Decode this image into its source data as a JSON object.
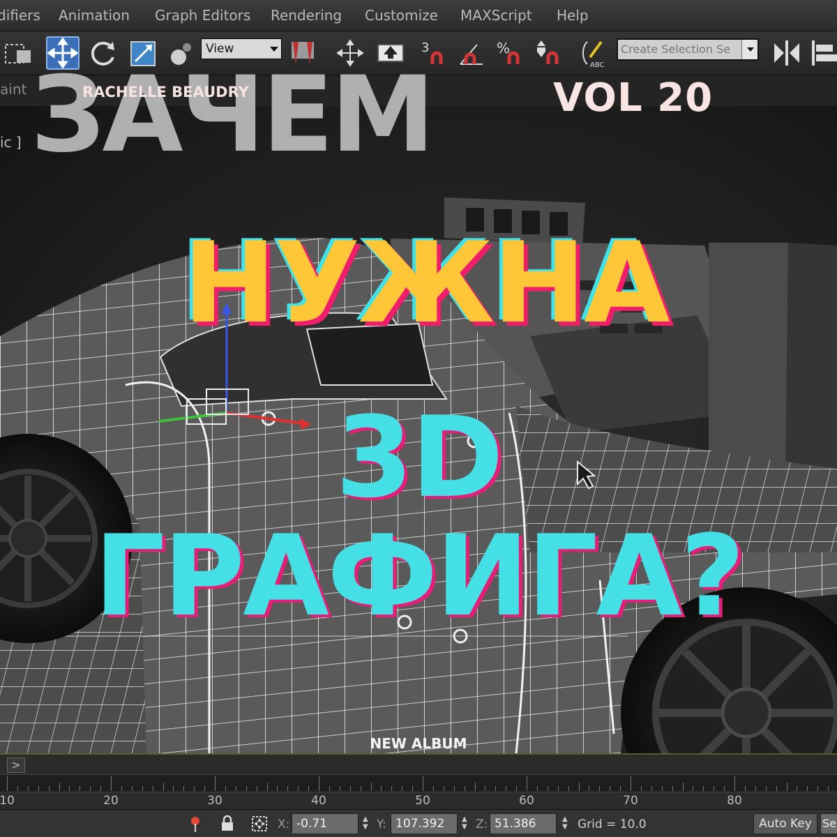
{
  "menu": [
    "difiers",
    "Animation",
    "Graph Editors",
    "Rendering",
    "Customize",
    "MAXScript",
    "Help"
  ],
  "toolbar": {
    "view_dropdown": "View",
    "snap_labels": [
      "3",
      "%"
    ],
    "selection_set_placeholder": "Create Selection Se"
  },
  "ribbon": {
    "label": "aint"
  },
  "viewport": {
    "label": "ic ]"
  },
  "poster": {
    "title_top": "ЗАЧЕМ",
    "artist": "RACHELLE BEAUDRY",
    "volume": "VOL 20",
    "line1": "НУЖНА",
    "line2": "3D",
    "line3": "ГРАФИГА?",
    "album": "NEW ALBUM",
    "colors": {
      "yellow": "#ffc637",
      "cyan": "#45dfe6",
      "magenta": "#e51f78",
      "pink_white": "#f9e4e4",
      "grey": "#b8b8b8"
    }
  },
  "timeline": {
    "arrow": ">",
    "ticks": [
      "10",
      "20",
      "30",
      "40",
      "50",
      "60",
      "70",
      "80"
    ]
  },
  "status": {
    "x_label": "X:",
    "x_value": "-0.71",
    "y_label": "Y:",
    "y_value": "107.392",
    "z_label": "Z:",
    "z_value": "51.386",
    "grid": "Grid = 10.0",
    "autokey": "Auto Key",
    "end_field": "Se"
  },
  "icons": [
    "select-object-icon",
    "move-icon",
    "rotate-icon",
    "scale-icon",
    "select-link-icon",
    "mirror-icon",
    "pivot-icon",
    "snap-3d-icon",
    "angle-snap-icon",
    "percent-snap-icon",
    "spinner-snap-icon",
    "edit-named-selection-icon",
    "mirror-tool-icon",
    "align-icon",
    "lock-icon",
    "absolute-mode-icon",
    "isolate-icon"
  ]
}
